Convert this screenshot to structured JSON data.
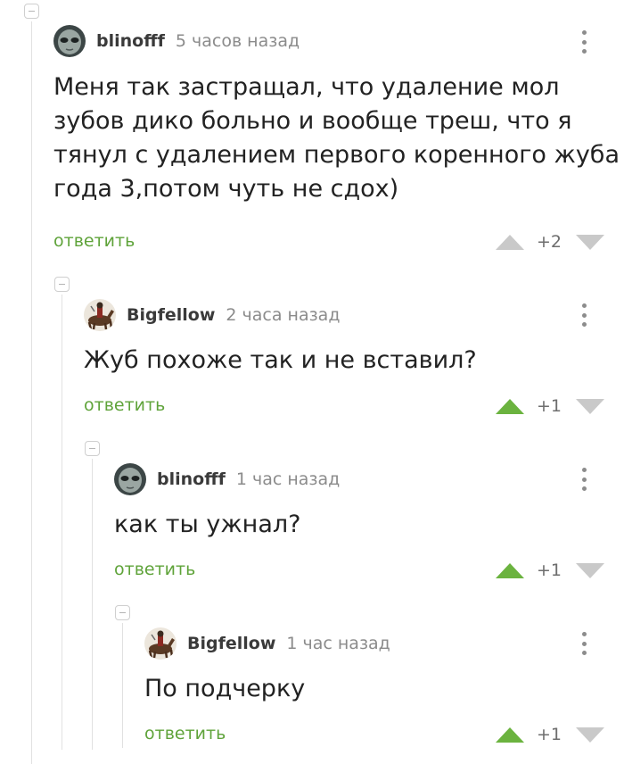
{
  "comments": [
    {
      "username": "blinofff",
      "time": "5 часов назад",
      "text": [
        "Меня так застращал, что удаление мол",
        "зубов дико больно и вообще треш, что я",
        "тянул с удалением первого коренного жуба",
        "года 3,потом чуть не сдох)"
      ],
      "reply_label": "ответить",
      "score": "+2",
      "upvoted": false
    },
    {
      "username": "Bigfellow",
      "time": "2 часа назад",
      "text": [
        "Жуб похоже так и не вставил?"
      ],
      "reply_label": "ответить",
      "score": "+1",
      "upvoted": true
    },
    {
      "username": "blinofff",
      "time": "1 час назад",
      "text": [
        "как ты ужнал?"
      ],
      "reply_label": "ответить",
      "score": "+1",
      "upvoted": true
    },
    {
      "username": "Bigfellow",
      "time": "1 час назад",
      "text": [
        "По подчерку"
      ],
      "reply_label": "ответить",
      "score": "+1",
      "upvoted": true
    }
  ],
  "colors": {
    "upvote_active": "#6bb33f",
    "vote_inactive": "#c9c9c9",
    "reply": "#5fa33a"
  },
  "icons": {
    "avatar_blinofff": "alien-face-avatar",
    "avatar_bigfellow": "horse-rider-avatar",
    "more": "vertical-dots-icon",
    "upvote": "triangle-up-icon",
    "downvote": "triangle-down-icon",
    "collapse": "collapse-minus-icon"
  }
}
